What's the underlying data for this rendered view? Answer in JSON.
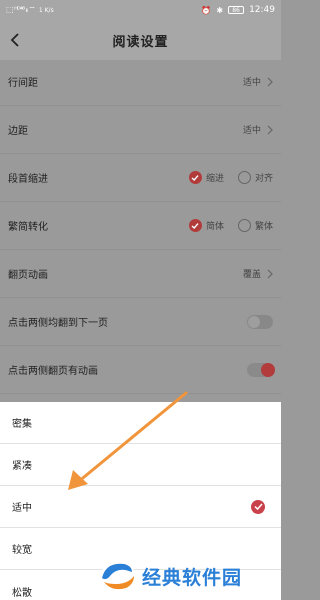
{
  "status_bar": {
    "left_glyphs": "⬚ ᴴᴰ⁴⁶ ᵢₗₗ ⌔",
    "net_speed": "1 K/s",
    "clock": "12:49",
    "battery": "86"
  },
  "header": {
    "title": "阅读设置"
  },
  "settings": {
    "line_spacing": {
      "label": "行间距",
      "value": "适中"
    },
    "margin": {
      "label": "边距",
      "value": "适中"
    },
    "indent": {
      "label": "段首缩进",
      "option_a": "缩进",
      "option_b": "对齐",
      "selected": "缩进"
    },
    "conversion": {
      "label": "繁简转化",
      "option_a": "简体",
      "option_b": "繁体",
      "selected": "简体"
    },
    "page_animation": {
      "label": "翻页动画",
      "value": "覆盖"
    },
    "tap_both_sides": {
      "label": "点击两侧均翻到下一页",
      "enabled": false
    },
    "tap_animation": {
      "label": "点击两侧翻页有动画",
      "enabled": true
    }
  },
  "sheet": {
    "options": [
      "密集",
      "紧凑",
      "适中",
      "较宽",
      "松散"
    ],
    "selected": "适中"
  },
  "watermark": {
    "text": "经典软件园"
  },
  "colors": {
    "accent": "#c9414a",
    "arrow": "#f0953c",
    "watermark": "#2a7fd6"
  }
}
